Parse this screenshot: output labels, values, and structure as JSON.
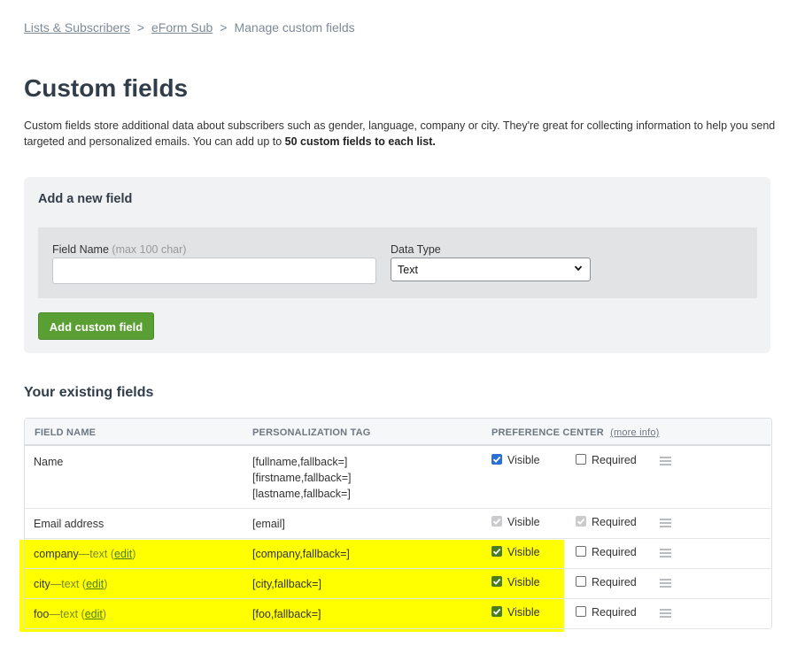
{
  "breadcrumb": {
    "items": [
      "Lists & Subscribers",
      "eForm Sub"
    ],
    "separator": ">",
    "current": "Manage custom fields"
  },
  "page": {
    "title": "Custom fields",
    "intro_text": "Custom fields store additional data about subscribers such as gender, language, company or city. They're great for collecting information to help you send targeted and personalized emails. You can add up to ",
    "intro_bold": "50 custom fields to each list."
  },
  "add_field": {
    "title": "Add a new field",
    "field_name_label": "Field Name",
    "field_name_hint": "(max 100 char)",
    "field_name_value": "",
    "data_type_label": "Data Type",
    "data_type_value": "Text",
    "button_label": "Add custom field"
  },
  "existing": {
    "title": "Your existing fields",
    "columns": {
      "field_name": "FIELD NAME",
      "tag": "PERSONALIZATION TAG",
      "pref": "PREFERENCE CENTER",
      "more_info": "(more info)"
    },
    "visible_label": "Visible",
    "required_label": "Required",
    "rows": [
      {
        "name": "Name",
        "tags": [
          "[fullname,fallback=]",
          "[firstname,fallback=]",
          "[lastname,fallback=]"
        ],
        "visible": true,
        "required": false
      },
      {
        "name": "Email address",
        "tags": [
          "[email]"
        ],
        "visible": true,
        "required": true,
        "disabled": true
      },
      {
        "name": "company",
        "dash": "—",
        "type": "text",
        "edit_label": "edit",
        "tags": [
          "[company,fallback=]"
        ],
        "visible": true,
        "required": false
      },
      {
        "name": "city",
        "dash": "—",
        "type": "text",
        "edit_label": "edit",
        "tags": [
          "[city,fallback=]"
        ],
        "visible": true,
        "required": false
      },
      {
        "name": "foo",
        "dash": "—",
        "type": "text",
        "edit_label": "edit",
        "tags": [
          "[foo,fallback=]"
        ],
        "visible": true,
        "required": false
      }
    ]
  },
  "colors": {
    "highlight": "#ffff00",
    "button_green": "#5a9f33",
    "checkbox_blue": "#2a6fd6",
    "checkbox_green": "#4a7d1f"
  }
}
